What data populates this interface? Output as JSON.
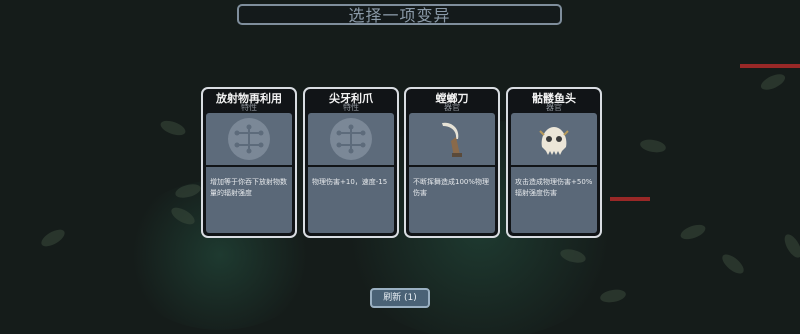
{
  "title": "选择一项变异",
  "cards": [
    {
      "name": "放射物再利用",
      "type": "特性",
      "icon": "trait-node-icon",
      "desc": "增加等于你吞下放射物数量的辐射强度"
    },
    {
      "name": "尖牙利爪",
      "type": "特性",
      "icon": "trait-node-icon",
      "desc": "物理伤害+10，速度-15"
    },
    {
      "name": "螳螂刀",
      "type": "器官",
      "icon": "mantis-blade-icon",
      "desc": "不断挥舞造成100%物理伤害"
    },
    {
      "name": "骷髅鱼头",
      "type": "器官",
      "icon": "fish-skull-icon",
      "desc": "攻击造成物理伤害+50%辐射强度伤害"
    }
  ],
  "refresh_button": "刷新 (1)",
  "colors": {
    "card_border": "#d9dde2",
    "card_panel": "#5d6b7b",
    "background": "#151c1a",
    "accent_red": "#b02a2a"
  }
}
